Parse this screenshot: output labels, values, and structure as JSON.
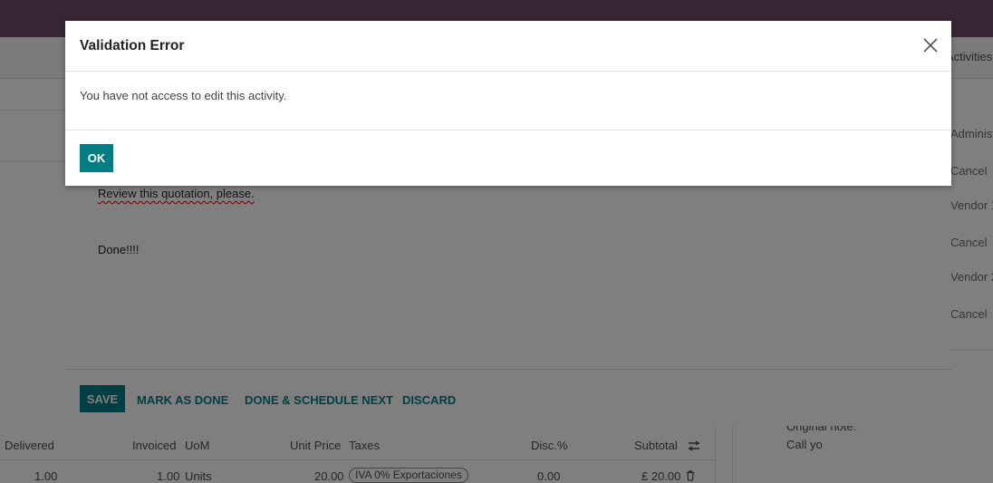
{
  "background": {
    "chatter": {
      "activities_label": "Activities",
      "lines": [
        "Administ",
        "Cancel",
        "Vendor 1",
        "Cancel",
        "Vendor 2",
        "Cancel"
      ],
      "original_note_label": "Original note:",
      "original_note_text": "Call yo"
    },
    "order_lines": {
      "headers": {
        "delivered": "Delivered",
        "invoiced": "Invoiced",
        "uom": "UoM",
        "unit_price": "Unit Price",
        "taxes": "Taxes",
        "disc": "Disc.%",
        "subtotal": "Subtotal"
      },
      "rows": [
        {
          "delivered": "1.00",
          "invoiced": "1.00",
          "uom": "Units",
          "unit_price": "20.00",
          "tax": "IVA 0% Exportaciones",
          "disc": "0.00",
          "subtotal": "£ 20.00"
        }
      ]
    }
  },
  "activity_dialog": {
    "lines": [
      "Review this quotation, please.",
      "Done!!!!"
    ],
    "buttons": {
      "save": "SAVE",
      "mark_done": "MARK AS DONE",
      "done_schedule_next": "DONE & SCHEDULE NEXT",
      "discard": "DISCARD"
    }
  },
  "error_modal": {
    "title": "Validation Error",
    "message": "You have not access to edit this activity.",
    "ok_label": "OK"
  },
  "colors": {
    "navbar": "#714b67",
    "primary": "#017e84"
  }
}
